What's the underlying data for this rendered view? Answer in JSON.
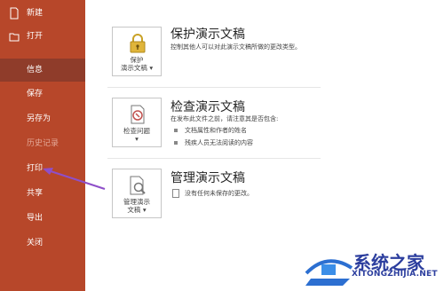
{
  "sidebar": {
    "items": [
      {
        "label": "新建",
        "icon": "new-icon"
      },
      {
        "label": "打开",
        "icon": "open-folder-icon"
      },
      {
        "label": "信息"
      },
      {
        "label": "保存"
      },
      {
        "label": "另存为"
      },
      {
        "label": "历史记录"
      },
      {
        "label": "打印"
      },
      {
        "label": "共享"
      },
      {
        "label": "导出"
      },
      {
        "label": "关闭"
      }
    ],
    "active_index": 2,
    "bg_color": "#b7472a",
    "active_color": "#8f3c2a"
  },
  "sections": [
    {
      "tile_line1": "保护",
      "tile_line2": "演示文稿",
      "title": "保护演示文稿",
      "desc": "控制其他人可以对此演示文稿所做的更改类型。",
      "icon": "lock-icon"
    },
    {
      "tile_line1": "检查问题",
      "title": "检查演示文稿",
      "desc": "在发布此文件之前，请注意其是否包含:",
      "bullets": [
        "文档属性和作者的姓名",
        "残疾人员无法阅读的内容"
      ],
      "icon": "inspect-icon"
    },
    {
      "tile_line1": "管理演示",
      "tile_line2": "文稿",
      "title": "管理演示文稿",
      "desc": "没有任何未保存的更改。",
      "icon": "manage-icon"
    }
  ],
  "watermark": {
    "text": "系统之家",
    "url": "XITONGZHIJIA.NET"
  },
  "annotation": {
    "arrow_color": "#8e4fc9"
  }
}
